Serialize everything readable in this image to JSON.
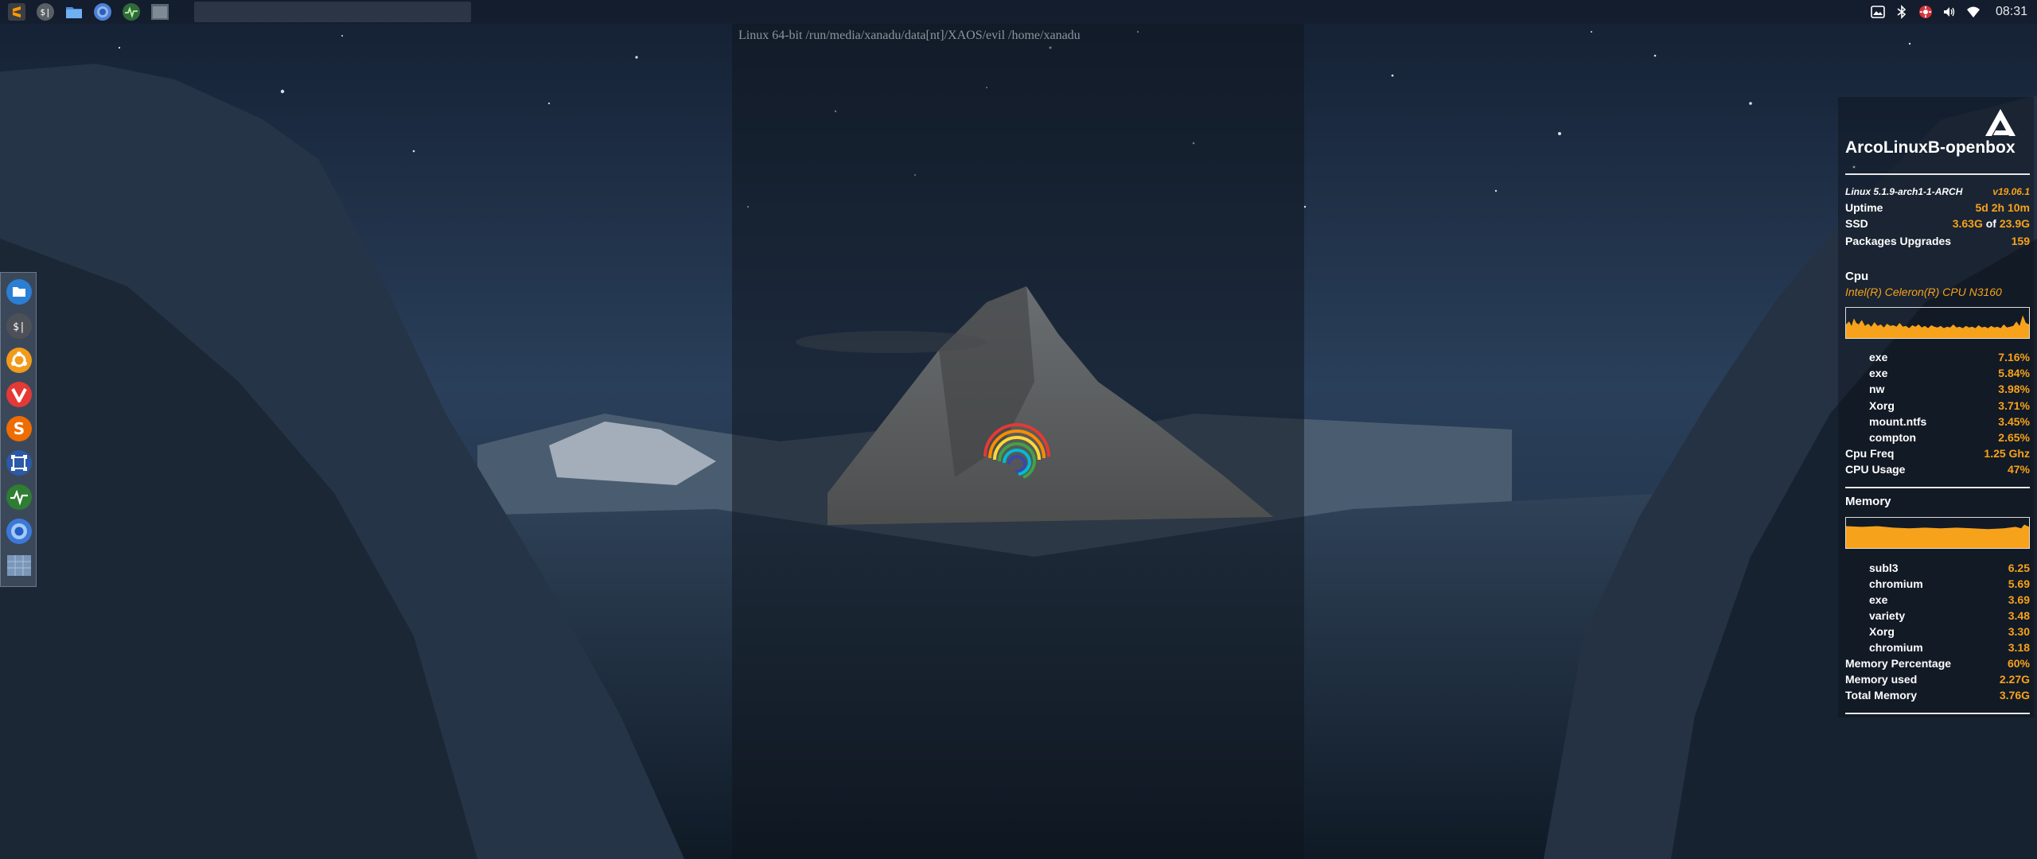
{
  "desktop": {
    "path_text": "Linux 64-bit /run/media/xanadu/data[nt]/XAOS/evil /home/xanadu"
  },
  "top_panel": {
    "launchers": [
      {
        "name": "sublime-text-icon"
      },
      {
        "name": "terminal-icon"
      },
      {
        "name": "folder-icon"
      },
      {
        "name": "chromium-icon"
      },
      {
        "name": "system-monitor-icon"
      },
      {
        "name": "window-thumbnail-icon"
      }
    ],
    "tray": [
      {
        "name": "screenshot-icon"
      },
      {
        "name": "bluetooth-icon"
      },
      {
        "name": "update-notifier-icon"
      },
      {
        "name": "volume-icon"
      },
      {
        "name": "wifi-icon"
      }
    ],
    "clock": "08:31"
  },
  "dock": {
    "items": [
      {
        "name": "file-manager-icon"
      },
      {
        "name": "terminal-icon"
      },
      {
        "name": "ubuntu-circle-icon"
      },
      {
        "name": "vivaldi-icon"
      },
      {
        "name": "sublime-text-icon"
      },
      {
        "name": "screenshot-tool-icon"
      },
      {
        "name": "system-monitor-icon"
      },
      {
        "name": "chromium-icon"
      },
      {
        "name": "show-desktop-icon"
      }
    ]
  },
  "conky": {
    "hostname": "ArcoLinuxB-openbox",
    "kernel": "Linux 5.1.9-arch1-1-ARCH",
    "version": "v19.06.1",
    "uptime_label": "Uptime",
    "uptime_value": "5d 2h 10m",
    "ssd_label": "SSD",
    "ssd_used": "3.63G",
    "ssd_of": " of ",
    "ssd_total": "23.9G",
    "packages_label": "Packages Upgrades",
    "packages_value": "159",
    "cpu_heading": "Cpu",
    "cpu_name": "Intel(R) Celeron(R) CPU  N3160",
    "cpu_processes": [
      {
        "name": "exe",
        "value": "7.16%"
      },
      {
        "name": "exe",
        "value": "5.84%"
      },
      {
        "name": "nw",
        "value": "3.98%"
      },
      {
        "name": "Xorg",
        "value": "3.71%"
      },
      {
        "name": "mount.ntfs",
        "value": "3.45%"
      },
      {
        "name": "compton",
        "value": "2.65%"
      }
    ],
    "cpu_freq_label": "Cpu Freq",
    "cpu_freq_value": "1.25 Ghz",
    "cpu_usage_label": "CPU Usage",
    "cpu_usage_value": "47%",
    "memory_heading": "Memory",
    "mem_processes": [
      {
        "name": "subl3",
        "value": "6.25"
      },
      {
        "name": "chromium",
        "value": "5.69"
      },
      {
        "name": "exe",
        "value": "3.69"
      },
      {
        "name": "variety",
        "value": "3.48"
      },
      {
        "name": "Xorg",
        "value": "3.30"
      },
      {
        "name": "chromium",
        "value": "3.18"
      }
    ],
    "mem_pct_label": "Memory Percentage",
    "mem_pct_value": "60%",
    "mem_used_label": "Memory used",
    "mem_used_value": "2.27G",
    "mem_total_label": "Total Memory",
    "mem_total_value": "3.76G",
    "colors": {
      "accent": "#f7a21b",
      "text": "#ffffff"
    }
  }
}
